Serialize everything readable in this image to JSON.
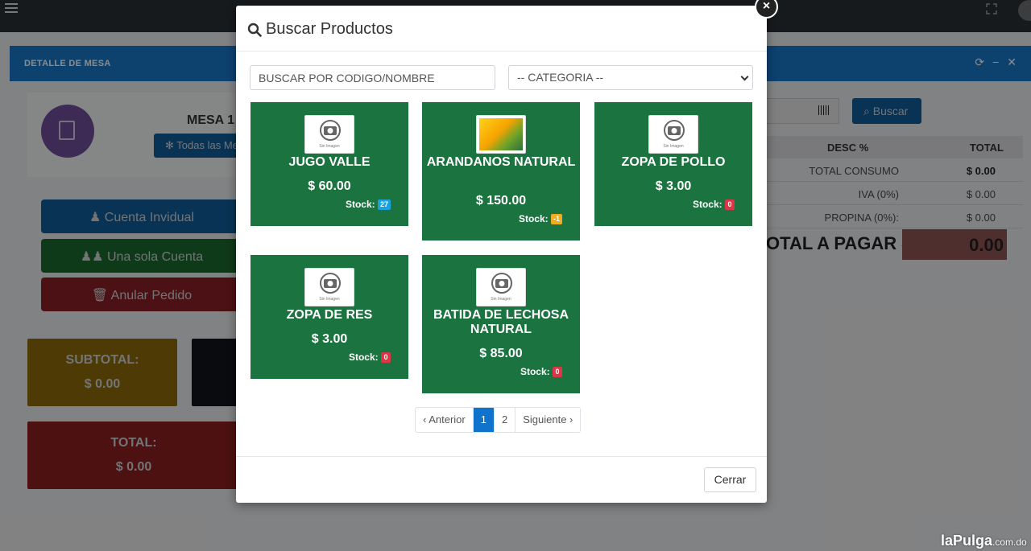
{
  "background": {
    "panel_title": "DETALLE DE MESA",
    "mesa_title": "MESA 1",
    "todas_mesas_label": "Todas las Mesas",
    "buttons": {
      "cuenta_individual": "Cuenta Invidual",
      "una_sola_cuenta": "Una sola Cuenta",
      "anular_pedido": "Anular Pedido"
    },
    "subtotal_label": "SUBTOTAL:",
    "subtotal_value": "$ 0.00",
    "total_label": "TOTAL:",
    "total_value": "$ 0.00",
    "buscar_label": "Buscar",
    "table_headers": [
      "DESC %",
      "TOTAL"
    ],
    "summary": [
      {
        "label": "TOTAL CONSUMO",
        "value": "$ 0.00"
      },
      {
        "label": "IVA (0%)",
        "value": "$ 0.00"
      },
      {
        "label": "PROPINA (0%):",
        "value": "$ 0.00"
      }
    ],
    "total_pagar_label": "TOTAL A PAGAR $",
    "total_pagar_value": "0.00"
  },
  "modal": {
    "title": "Buscar Productos",
    "search_placeholder": "BUSCAR POR CODIGO/NOMBRE",
    "category_selected": "-- CATEGORIA --",
    "sin_imagen": "Sin Imagen",
    "stock_label": "Stock:",
    "products": [
      {
        "name": "JUGO VALLE",
        "price": "$ 60.00",
        "stock": "27",
        "badge_color": "#17a2e0"
      },
      {
        "name": "ARANDANOS NATURAL",
        "price": "$ 150.00",
        "stock": "-1",
        "badge_color": "#f0ad1e"
      },
      {
        "name": "ZOPA DE POLLO",
        "price": "$ 3.00",
        "stock": "0",
        "badge_color": "#dc3545"
      },
      {
        "name": "ZOPA DE RES",
        "price": "$ 3.00",
        "stock": "0",
        "badge_color": "#dc3545"
      },
      {
        "name": "BATIDA DE LECHOSA NATURAL",
        "price": "$ 85.00",
        "stock": "0",
        "badge_color": "#dc3545"
      }
    ],
    "pagination": {
      "prev": "‹ Anterior",
      "pages": [
        "1",
        "2"
      ],
      "active_page": "1",
      "next": "Siguiente ›"
    },
    "close_label": "Cerrar",
    "close_x": "×"
  },
  "watermark": {
    "brand": "laPulga",
    "domain": ".com.do"
  },
  "colors": {
    "product_card": "#1b7340",
    "header_blue": "#1877c8",
    "active_page": "#0f73cc"
  }
}
